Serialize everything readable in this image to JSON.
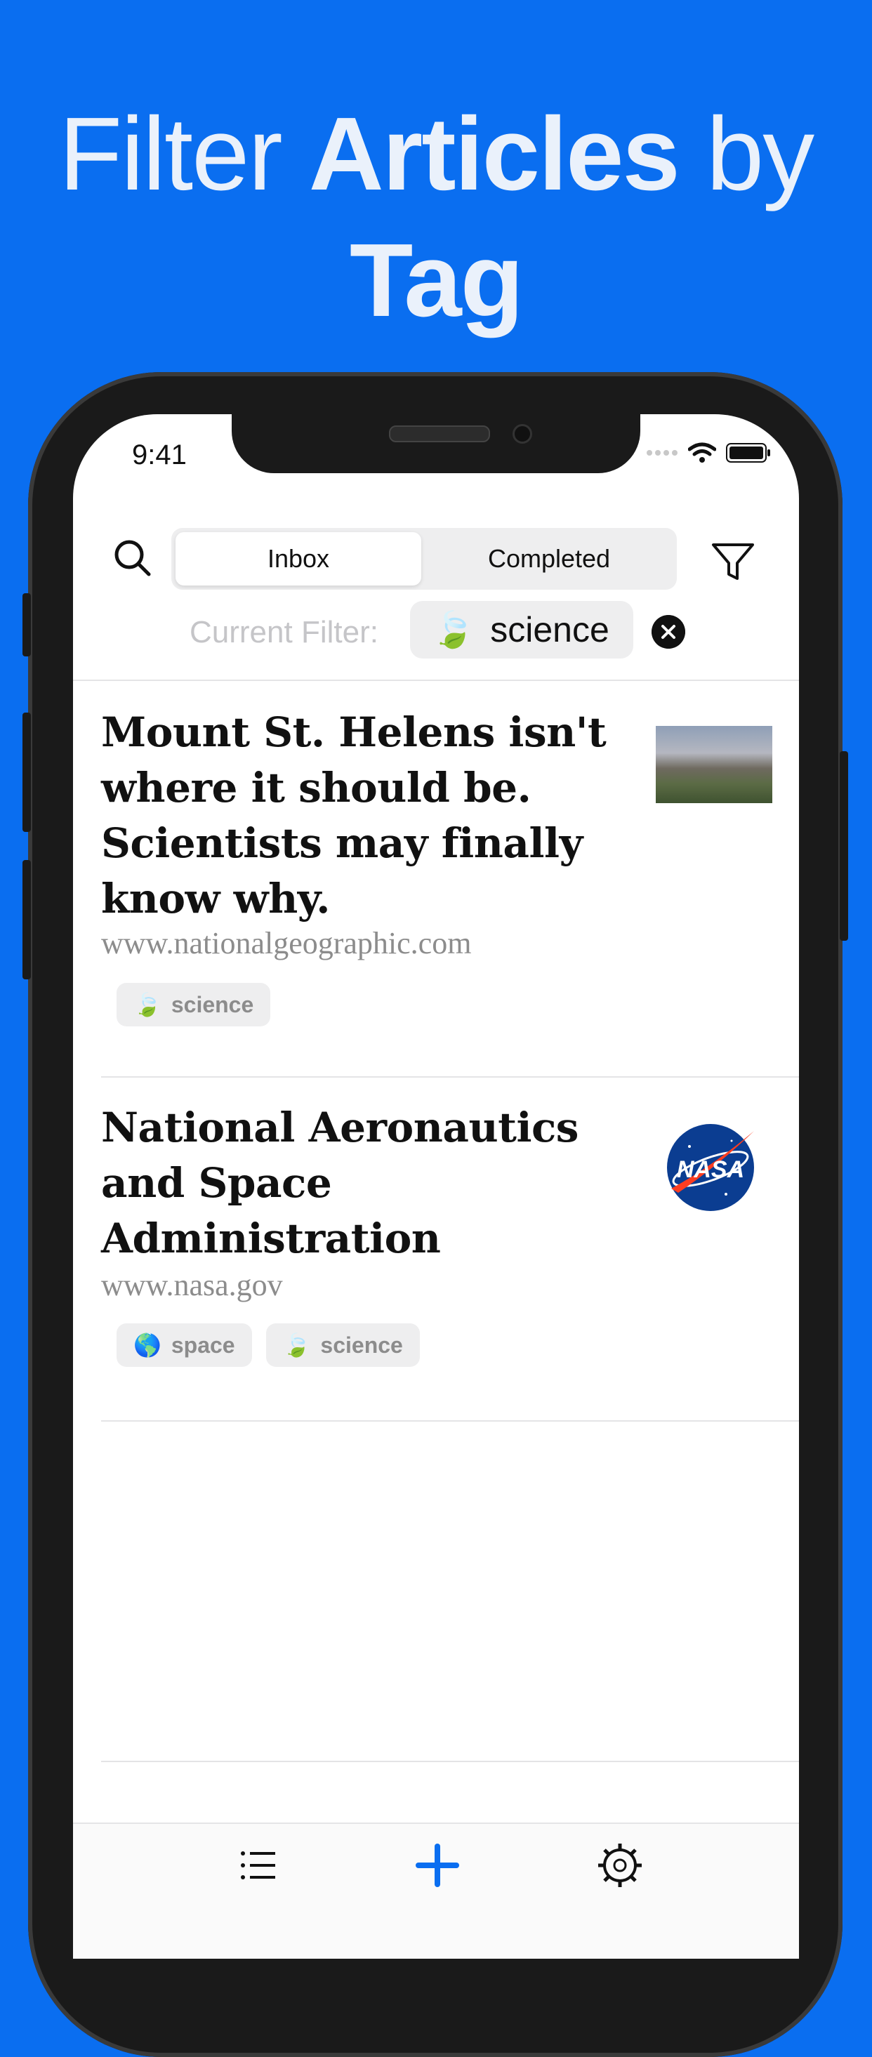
{
  "headline": {
    "line1_light": "Filter",
    "line1_bold": "Articles",
    "line1_end": "by",
    "line2_bold": "Tag"
  },
  "status_bar": {
    "time": "9:41"
  },
  "toolbar": {
    "search_icon": "search-icon",
    "tabs": [
      {
        "label": "Inbox",
        "active": true
      },
      {
        "label": "Completed",
        "active": false
      }
    ],
    "filter_icon": "funnel-icon"
  },
  "filter": {
    "label": "Current Filter:",
    "tag_emoji": "🍃",
    "tag": "science"
  },
  "articles": [
    {
      "title": "Mount St. Helens isn't where it should be. Scientists may finally know why.",
      "source": "www.nationalgeographic.com",
      "tags": [
        {
          "emoji": "🍃",
          "label": "science"
        }
      ]
    },
    {
      "title": "National Aeronautics and Space Administration",
      "source": "www.nasa.gov",
      "tags": [
        {
          "emoji": "🌎",
          "label": "space"
        },
        {
          "emoji": "🍃",
          "label": "science"
        }
      ],
      "logo_text": "NASA"
    }
  ],
  "tabbar": {
    "items": [
      "list-icon",
      "add-icon",
      "settings-gear-icon"
    ],
    "accent": "#0a6ef0"
  }
}
